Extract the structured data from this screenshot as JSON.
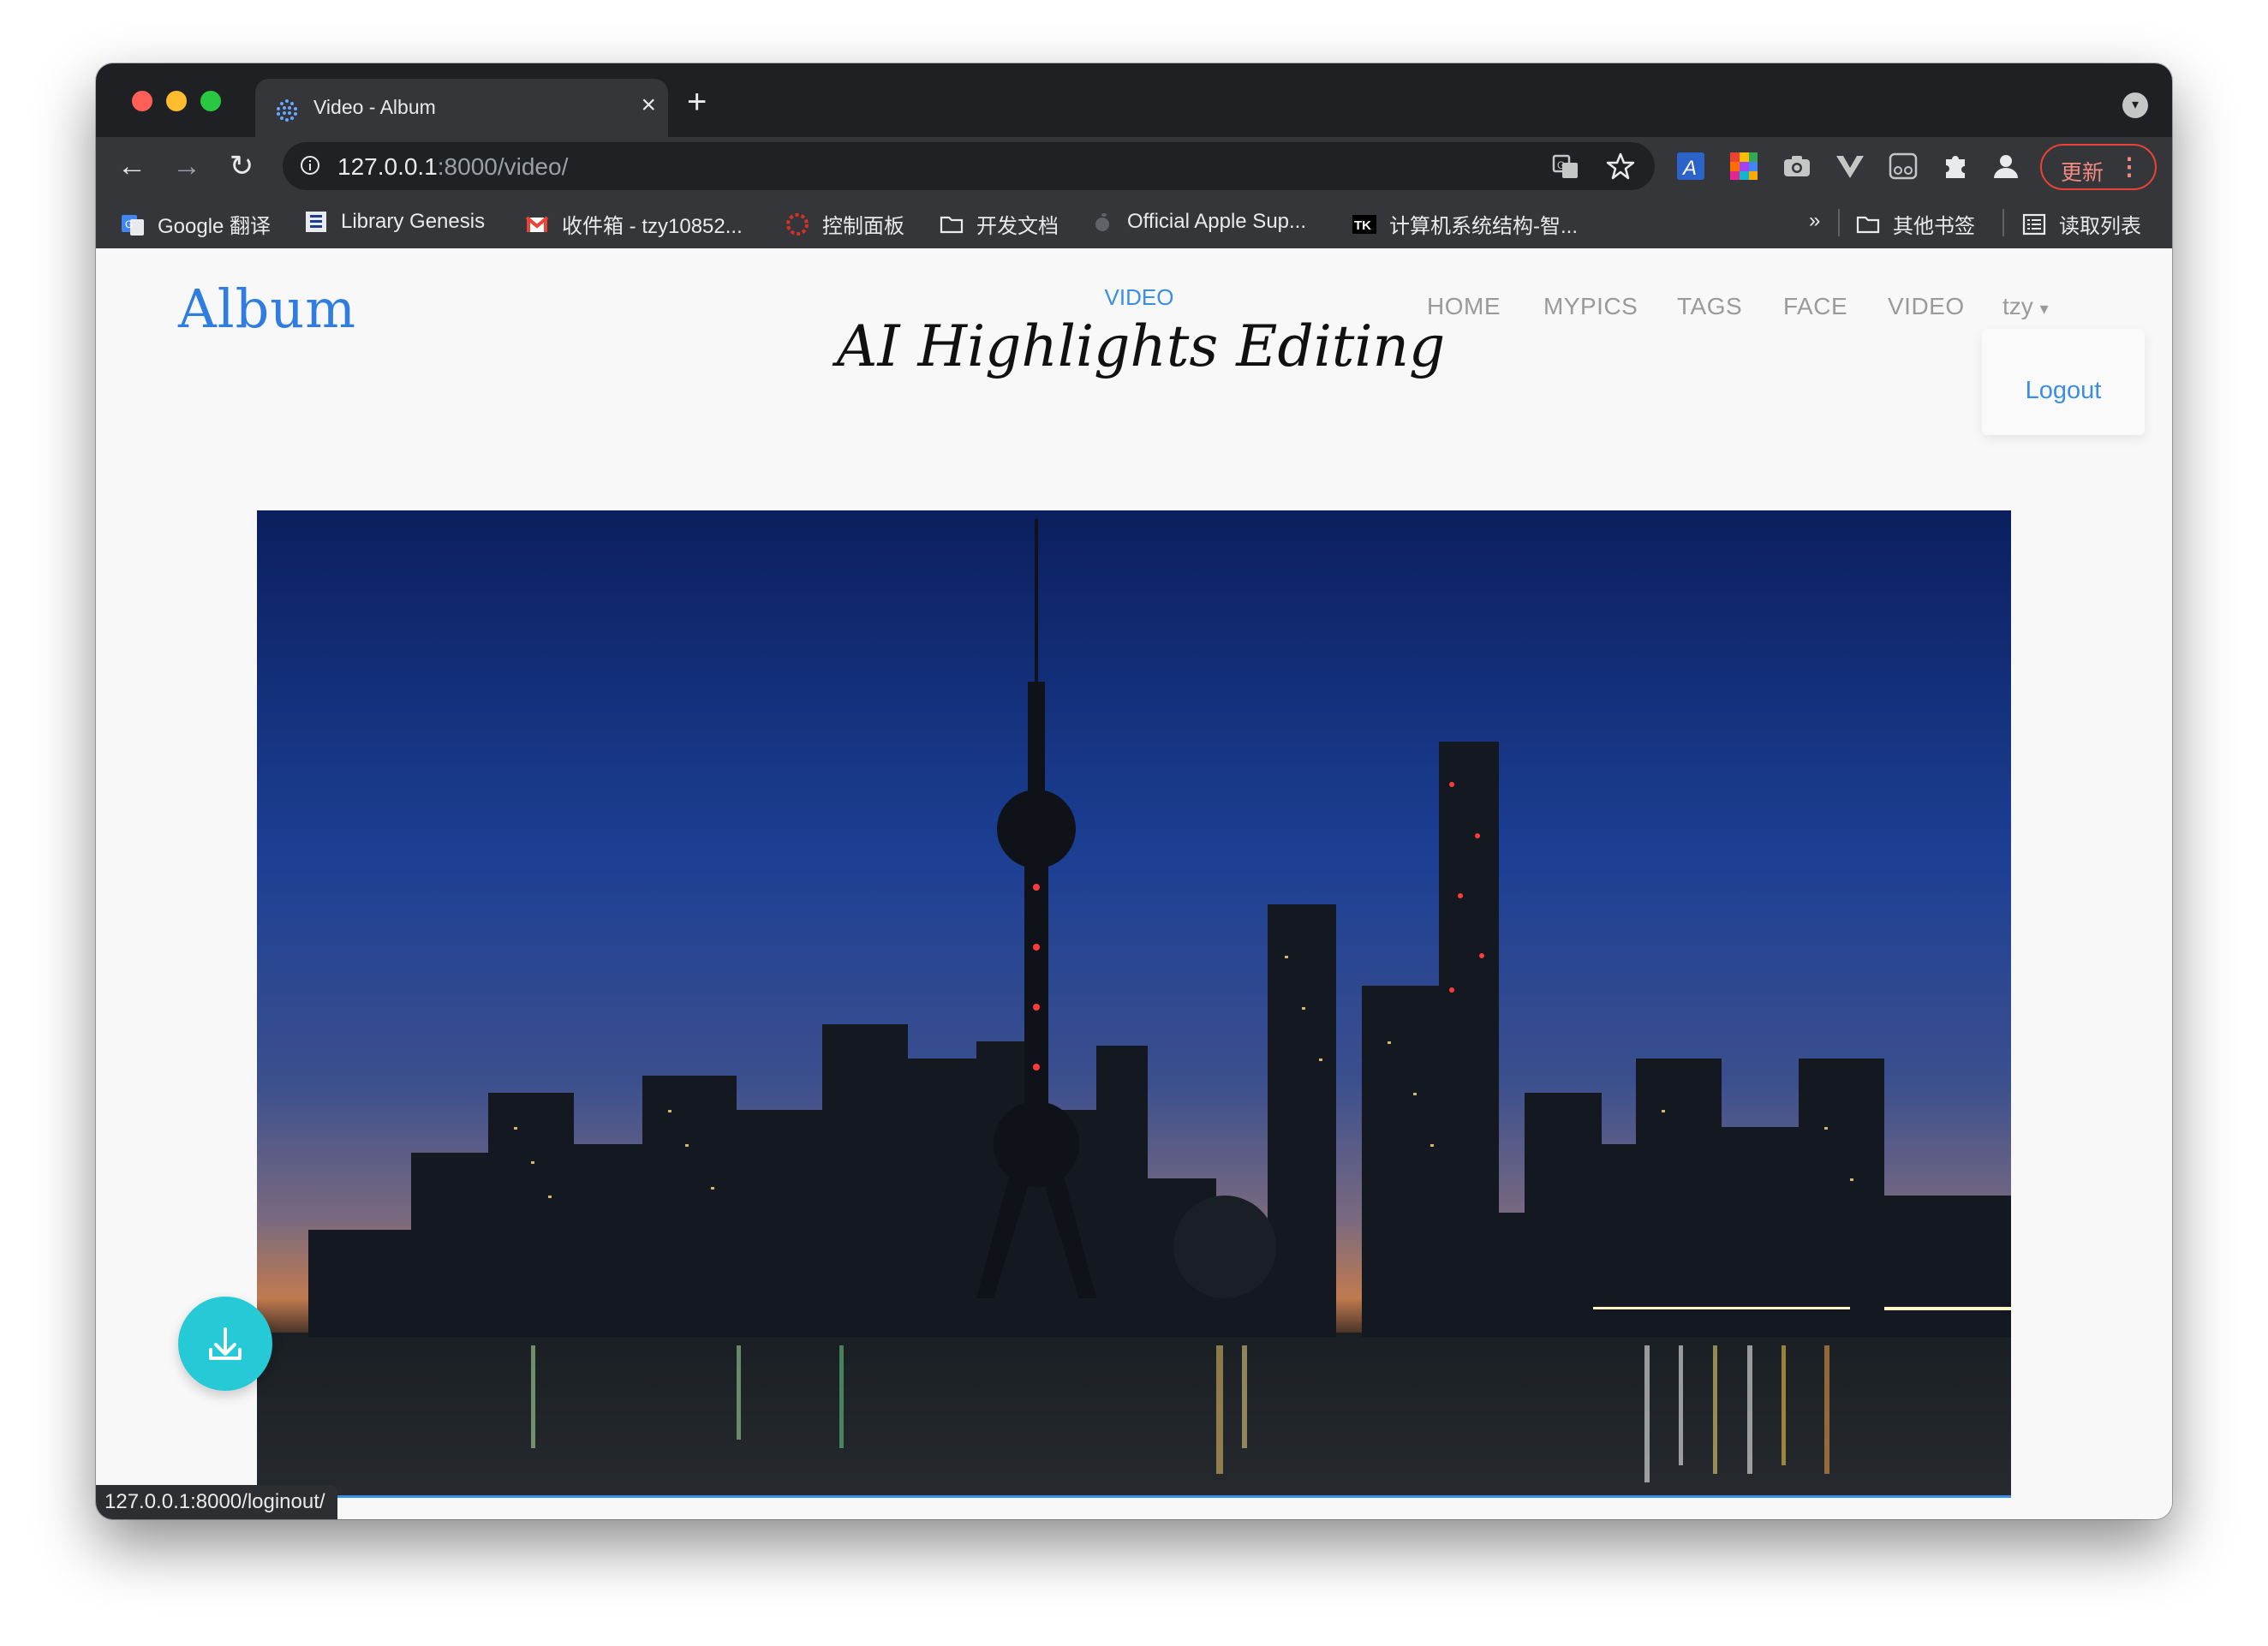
{
  "browser": {
    "tab": {
      "title": "Video - Album",
      "close_label": "×"
    },
    "new_tab_label": "+",
    "nav": {
      "back": "←",
      "forward": "→",
      "reload": "↻"
    },
    "omnibox": {
      "host": "127.0.0.1",
      "path": ":8000/video/"
    },
    "update_button": {
      "label": "更新",
      "menu": "⋮"
    },
    "bookmarks": [
      {
        "label": "Google 翻译",
        "icon": "google-translate-icon"
      },
      {
        "label": "Library Genesis",
        "icon": "library-genesis-icon"
      },
      {
        "label": "收件箱 - tzy10852...",
        "icon": "gmail-icon"
      },
      {
        "label": "控制面板",
        "icon": "control-panel-icon"
      },
      {
        "label": "开发文档",
        "icon": "folder-icon"
      },
      {
        "label": "Official Apple Sup...",
        "icon": "apple-icon"
      },
      {
        "label": "计算机系统结构-智...",
        "icon": "tk-icon"
      }
    ],
    "bookmarks_overflow": "»",
    "other_bookmarks": "其他书签",
    "reading_list": "读取列表",
    "status_url": "127.0.0.1:8000/loginout/"
  },
  "site": {
    "logo": "Album",
    "subtitle": "VIDEO",
    "title": "AI Highlights Editing",
    "nav": [
      "HOME",
      "MYPICS",
      "TAGS",
      "FACE",
      "VIDEO"
    ],
    "user": "tzy",
    "user_caret": "▾",
    "logout": "Logout"
  },
  "colors": {
    "accent": "#3a8ee6",
    "fab": "#26c9d6",
    "update": "#ea4335"
  }
}
